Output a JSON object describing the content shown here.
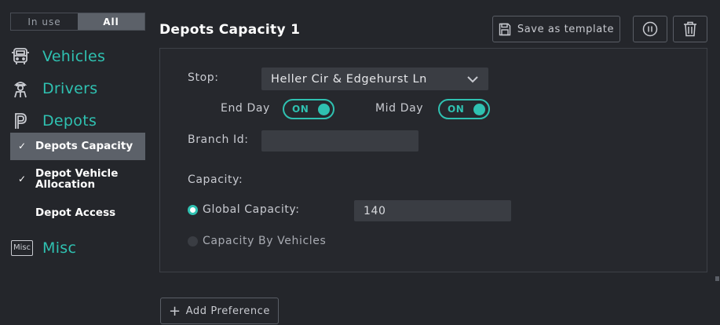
{
  "filter": {
    "in_use": "In use",
    "all": "All"
  },
  "nav": {
    "vehicles": "Vehicles",
    "drivers": "Drivers",
    "depots": "Depots",
    "depots_sub": [
      {
        "label": "Depots Capacity",
        "checked": true,
        "active": true
      },
      {
        "label": "Depot Vehicle Allocation",
        "checked": true,
        "active": false
      },
      {
        "label": "Depot Access",
        "checked": false,
        "active": false
      }
    ],
    "misc_icon_text": "Misc",
    "misc": "Misc"
  },
  "page": {
    "title": "Depots Capacity 1"
  },
  "toolbar": {
    "save_template": "Save as template"
  },
  "form": {
    "stop_label": "Stop:",
    "stop_value": "Heller Cir & Edgehurst Ln",
    "end_day_label": "End Day",
    "end_day_state": "ON",
    "mid_day_label": "Mid Day",
    "mid_day_state": "ON",
    "branch_id_label": "Branch Id:",
    "branch_id_value": "",
    "capacity_label": "Capacity:",
    "global_capacity_label": "Global Capacity:",
    "global_capacity_value": "140",
    "capacity_by_vehicles_label": "Capacity By Vehicles"
  },
  "footer": {
    "add_preference": "Add Preference"
  },
  "colors": {
    "accent": "#2fc1b1",
    "background": "#24262b",
    "active_item": "#5c6169"
  }
}
